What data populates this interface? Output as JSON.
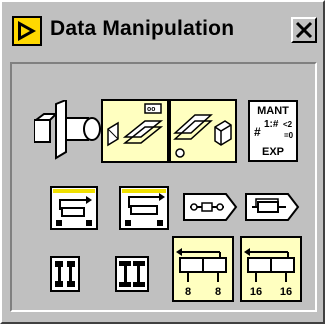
{
  "window": {
    "title": "Data Manipulation",
    "title_icon": "subpalette-arrow-icon",
    "close_icon": "close-x-icon"
  },
  "tools": [
    {
      "name": "flatten-to-string-tool",
      "icon": "flatten-icon"
    },
    {
      "name": "unflatten-from-string-tool",
      "icon": "unflatten-icon"
    },
    {
      "name": "type-cast-tool",
      "icon": "type-cast-icon"
    },
    {
      "name": "mantissa-exponent-tool",
      "icon": "mantissa-exponent-icon",
      "text": [
        "MANT",
        "1:#",
        "EXP"
      ]
    },
    {
      "name": "rotate-left-with-carry-tool",
      "icon": "rotate-carry-icon"
    },
    {
      "name": "rotate-right-with-carry-tool",
      "icon": "rotate-carry-icon"
    },
    {
      "name": "logical-shift-tool",
      "icon": "logical-shift-icon"
    },
    {
      "name": "rotate-tool",
      "icon": "rotate-icon"
    },
    {
      "name": "swap-bytes-tool",
      "icon": "swap-bytes-icon"
    },
    {
      "name": "swap-words-tool",
      "icon": "swap-words-icon"
    },
    {
      "name": "split-number-tool",
      "icon": "split-number-icon",
      "text": [
        "8",
        "8"
      ]
    },
    {
      "name": "join-numbers-tool",
      "icon": "join-numbers-icon",
      "text": [
        "16",
        "16"
      ]
    }
  ],
  "colors": {
    "face": "#c0c0c0",
    "tool_fill": "#ffffc0",
    "icon_accent": "#f0e000"
  }
}
